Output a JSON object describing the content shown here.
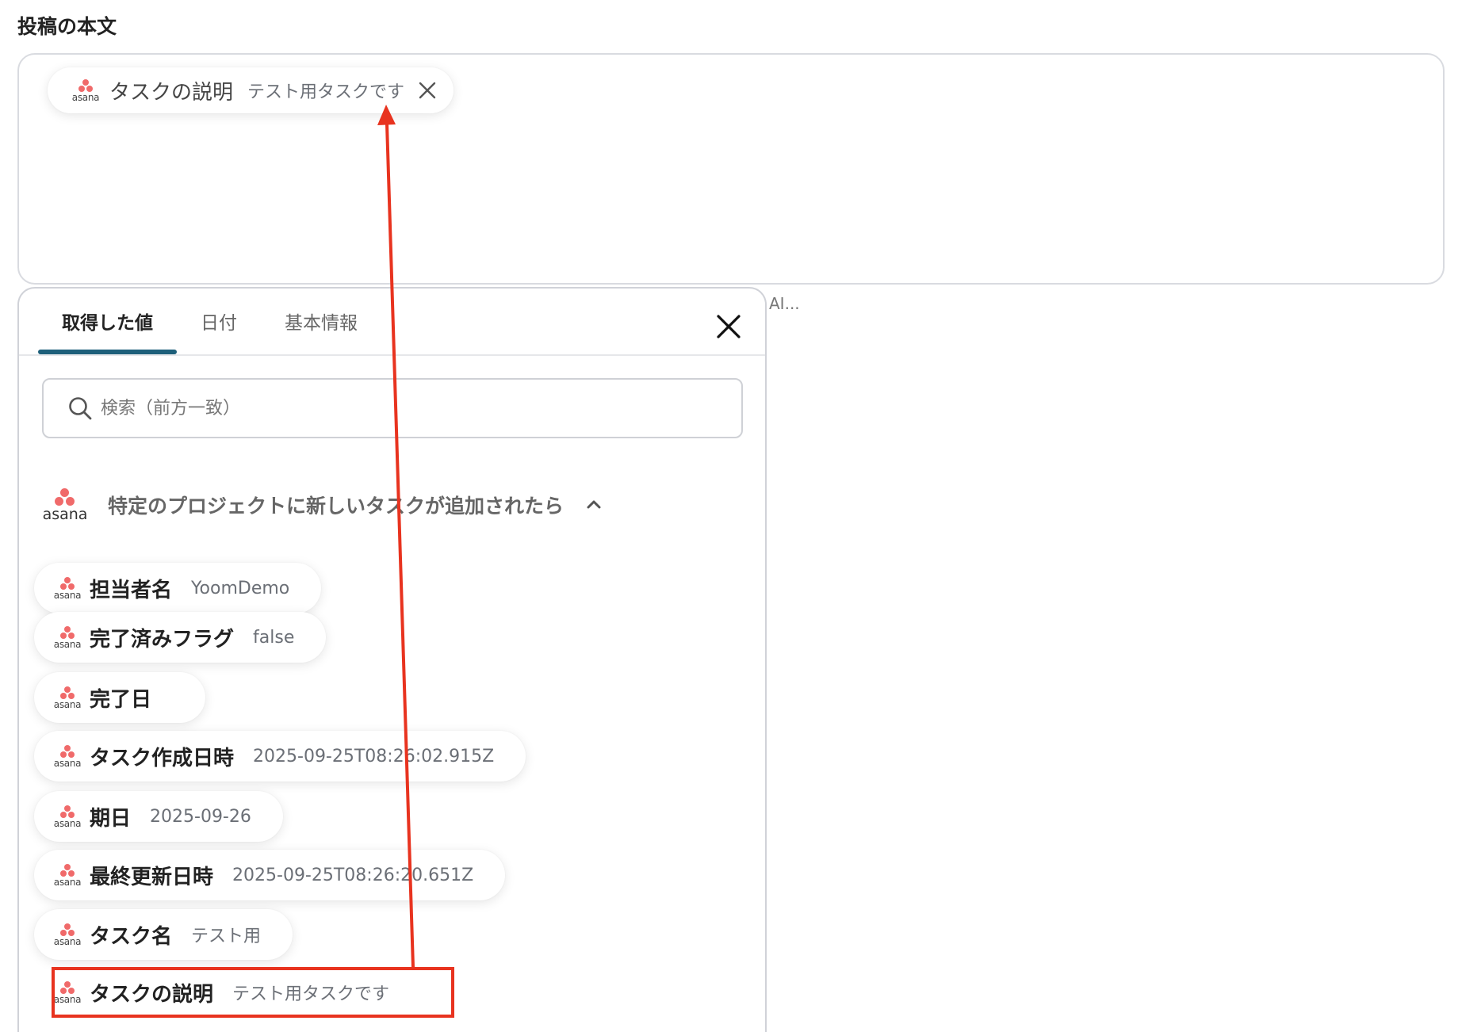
{
  "field": {
    "label": "投稿の本文"
  },
  "selected_chip": {
    "logo_text": "asana",
    "label": "タスクの説明",
    "value": "テスト用タスクです",
    "remove_icon": "close-icon"
  },
  "panel": {
    "tabs": [
      {
        "label": "取得した値",
        "active": true
      },
      {
        "label": "日付",
        "active": false
      },
      {
        "label": "基本情報",
        "active": false
      }
    ],
    "close_icon": "close-icon",
    "search": {
      "placeholder": "検索（前方一致）",
      "value": "",
      "icon": "search-icon"
    },
    "section": {
      "logo_text": "asana",
      "title": "特定のプロジェクトに新しいタスクが追加されたら",
      "expanded": true,
      "toggle_icon": "chevron-up-icon"
    },
    "items": [
      {
        "logo_text": "asana",
        "label": "担当者名",
        "value": "YoomDemo"
      },
      {
        "logo_text": "asana",
        "label": "完了済みフラグ",
        "value": "false"
      },
      {
        "logo_text": "asana",
        "label": "完了日",
        "value": ""
      },
      {
        "logo_text": "asana",
        "label": "タスク作成日時",
        "value": "2025-09-25T08:26:02.915Z"
      },
      {
        "logo_text": "asana",
        "label": "期日",
        "value": "2025-09-26"
      },
      {
        "logo_text": "asana",
        "label": "最終更新日時",
        "value": "2025-09-25T08:26:20.651Z"
      },
      {
        "logo_text": "asana",
        "label": "タスク名",
        "value": "テスト用"
      },
      {
        "logo_text": "asana",
        "label": "タスクの説明",
        "value": "テスト用タスクです",
        "highlighted": true
      }
    ]
  },
  "side_hint": "AI...",
  "colors": {
    "asana": "#f06a6a",
    "tab_underline": "#1d5f7a",
    "annotation": "#e8331f"
  }
}
